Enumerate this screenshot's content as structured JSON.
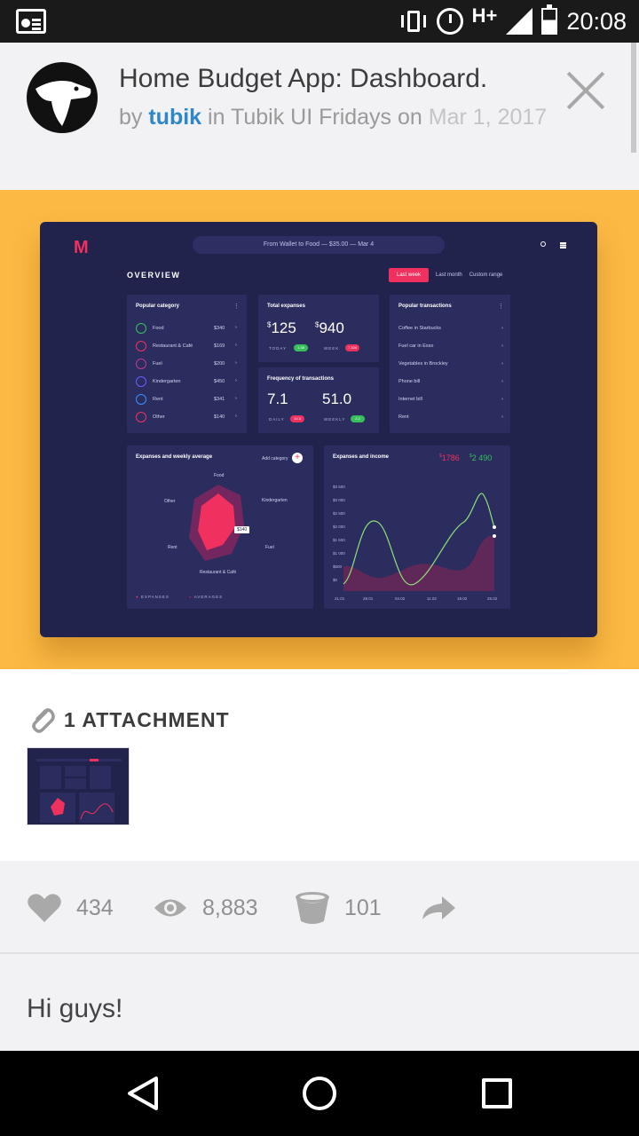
{
  "status_bar": {
    "network": "H+",
    "time": "20:08"
  },
  "post": {
    "title": "Home Budget App: Dashboard.",
    "by": "by",
    "author": "tubik",
    "in": "in",
    "channel": "Tubik UI Fridays",
    "on": "on",
    "date": "Mar 1, 2017"
  },
  "dashboard": {
    "logo": "M",
    "search_text": "From Wallet to Food — $35.00 — Mar 4",
    "overview": "OVERVIEW",
    "tabs": [
      "Last week",
      "Last month",
      "Custom range"
    ],
    "popular_title": "Popular category",
    "popular": [
      {
        "name": "Food",
        "value": "$340"
      },
      {
        "name": "Restaurant & Café",
        "value": "$169"
      },
      {
        "name": "Fuel",
        "value": "$200"
      },
      {
        "name": "Kindergarten",
        "value": "$450"
      },
      {
        "name": "Rent",
        "value": "$341"
      },
      {
        "name": "Other",
        "value": "$140"
      }
    ],
    "total_title": "Total expanses",
    "total_today": "125",
    "total_week": "940",
    "today_label": "TODAY",
    "week_label": "WEEK",
    "today_pill": "1.38",
    "week_pill": "7.104",
    "freq_title": "Frequency of transactions",
    "freq_daily": "7.1",
    "freq_weekly": "51.0",
    "daily_label": "DAILY",
    "weekly_label": "WEEKLY",
    "daily_pill": "10.3",
    "weekly_pill": "2.2",
    "trans_title": "Popular transactions",
    "transactions": [
      "Coffee in Starbucks",
      "Fuel car in Esso",
      "Vegetables in Brockley",
      "Phone bill",
      "Internet bill",
      "Rent"
    ],
    "radar_title": "Expanses and weekly average",
    "add_category": "Add category",
    "radar_labels": {
      "top": "Food",
      "tr": "Kindergarten",
      "r": "Fuel",
      "b": "Restaurant & Café",
      "l": "Rent",
      "tl": "Other"
    },
    "radar_tag": "$140",
    "legend_expanses": "EXPANSES",
    "legend_averages": "AVERAGES",
    "income_title": "Expanses and income",
    "income_red": "1786",
    "income_green": "2 490",
    "y_labels": [
      "$3 500",
      "$3 000",
      "$2 500",
      "$2 000",
      "$1 500",
      "$1 000",
      "$500",
      "$0"
    ],
    "x_labels": [
      "21.01",
      "28.01",
      "04.02",
      "11.02",
      "18.02",
      "25.02"
    ]
  },
  "attachments": {
    "label": "1 ATTACHMENT"
  },
  "stats": {
    "likes": "434",
    "views": "8,883",
    "buckets": "101"
  },
  "comment": "Hi guys!",
  "colors": {
    "accent": "#fcb944",
    "link": "#2f87c8",
    "dash_bg": "#22234d",
    "pink": "#f0305f",
    "green": "#36c05d"
  }
}
